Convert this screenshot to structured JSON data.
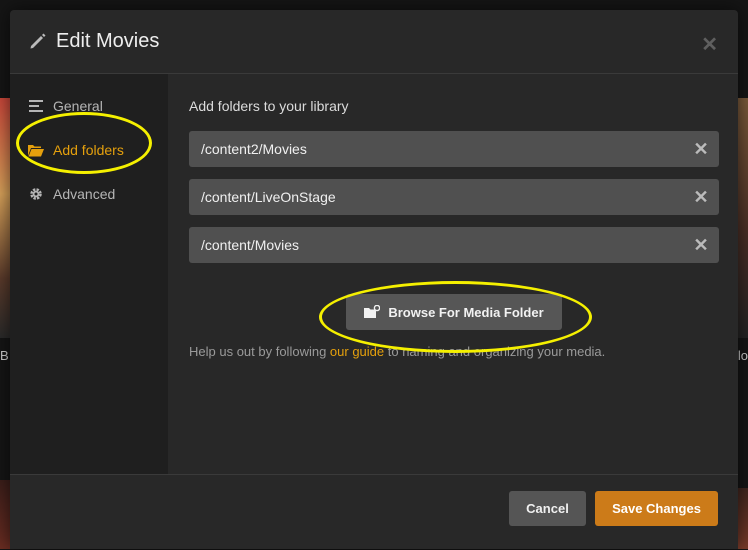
{
  "modal": {
    "title": "Edit Movies",
    "close_icon": "close-icon"
  },
  "sidebar": {
    "items": [
      {
        "label": "General",
        "icon": "list-icon",
        "active": false
      },
      {
        "label": "Add folders",
        "icon": "folder-open-icon",
        "active": true
      },
      {
        "label": "Advanced",
        "icon": "gear-icon",
        "active": false
      }
    ]
  },
  "content": {
    "section_label": "Add folders to your library",
    "folders": [
      {
        "path": "/content2/Movies"
      },
      {
        "path": "/content/LiveOnStage"
      },
      {
        "path": "/content/Movies"
      }
    ],
    "browse_label": "Browse For Media Folder",
    "help_prefix": "Help us out by following ",
    "help_link": "our guide",
    "help_suffix": " to naming and organizing your media."
  },
  "footer": {
    "cancel_label": "Cancel",
    "save_label": "Save Changes"
  },
  "background": {
    "left_text": "B",
    "right_text": "lo"
  },
  "colors": {
    "accent": "#e5a00d",
    "save_button": "#cc7b19",
    "annotation": "#f5f000"
  }
}
